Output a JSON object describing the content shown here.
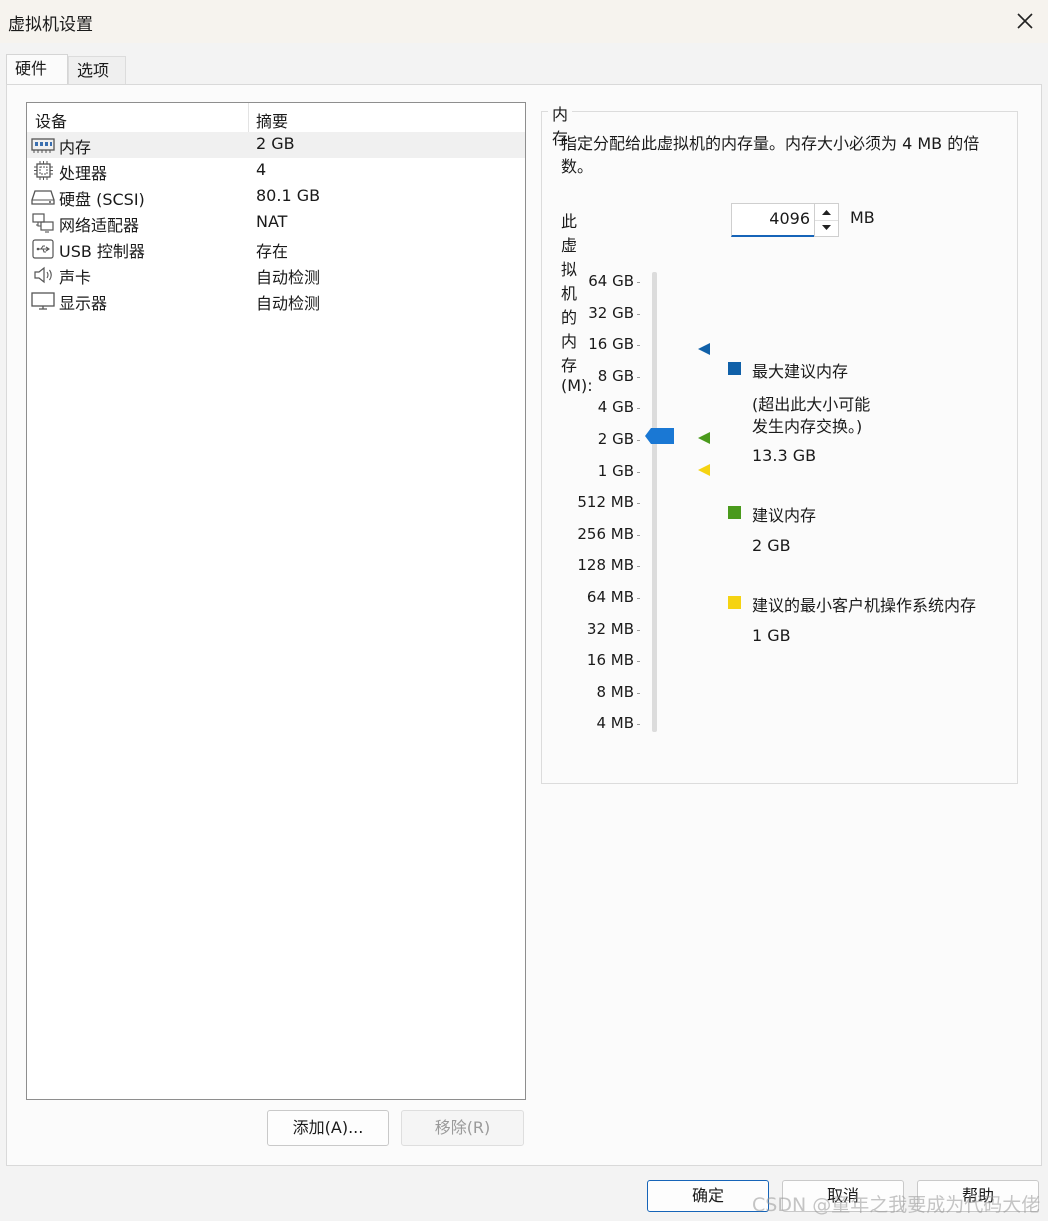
{
  "window": {
    "title": "虚拟机设置"
  },
  "tabs": [
    {
      "label": "硬件"
    },
    {
      "label": "选项"
    }
  ],
  "device_list": {
    "columns": {
      "device": "设备",
      "summary": "摘要"
    },
    "rows": [
      {
        "name": "内存",
        "value": "2 GB",
        "icon": "memory-icon"
      },
      {
        "name": "处理器",
        "value": "4",
        "icon": "cpu-icon"
      },
      {
        "name": "硬盘 (SCSI)",
        "value": "80.1 GB",
        "icon": "hard-disk-icon"
      },
      {
        "name": "网络适配器",
        "value": "NAT",
        "icon": "network-adapter-icon"
      },
      {
        "name": "USB 控制器",
        "value": "存在",
        "icon": "usb-icon"
      },
      {
        "name": "声卡",
        "value": "自动检测",
        "icon": "speaker-icon"
      },
      {
        "name": "显示器",
        "value": "自动检测",
        "icon": "monitor-icon"
      }
    ],
    "add_label": "添加(A)...",
    "remove_label": "移除(R)"
  },
  "memory": {
    "group_title": "内存",
    "description": "指定分配给此虚拟机的内存量。内存大小必须为 4 MB 的倍数。",
    "field_label": "此虚拟机的内存(M):",
    "value": "4096",
    "unit": "MB",
    "scale": [
      "64 GB",
      "32 GB",
      "16 GB",
      "8 GB",
      "4 GB",
      "2 GB",
      "1 GB",
      "512 MB",
      "256 MB",
      "128 MB",
      "64 MB",
      "32 MB",
      "16 MB",
      "8 MB",
      "4 MB"
    ],
    "legend": {
      "max": {
        "label": "最大建议内存",
        "note_line1": "(超出此大小可能",
        "note_line2": "发生内存交换。)",
        "value": "13.3 GB",
        "color": "#1060a8"
      },
      "recommended": {
        "label": "建议内存",
        "value": "2 GB",
        "color": "#4a9a1c"
      },
      "min": {
        "label": "建议的最小客户机操作系统内存",
        "value": "1 GB",
        "color": "#f5d312"
      }
    },
    "slider_color": "#1a78d4"
  },
  "footer": {
    "ok_label": "确定",
    "cancel_label": "取消",
    "help_label": "帮助"
  },
  "watermark": "CSDN @童年之我要成为代码大佬"
}
